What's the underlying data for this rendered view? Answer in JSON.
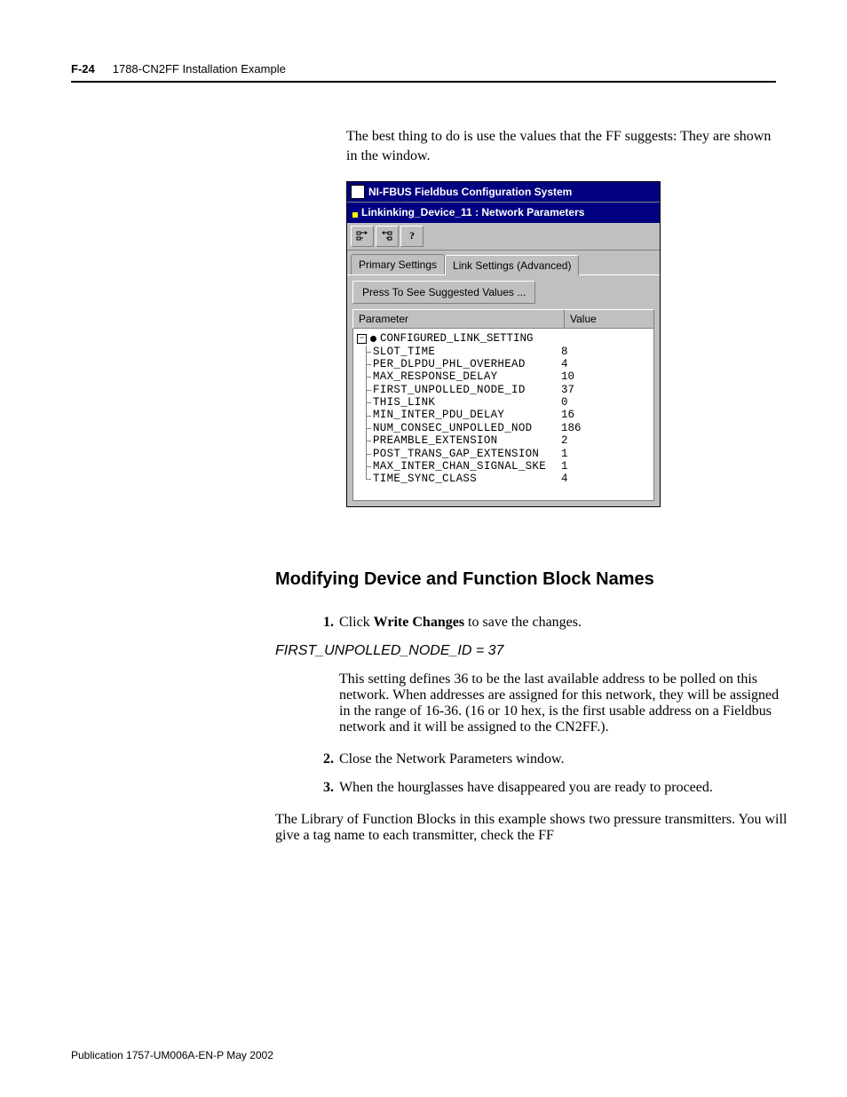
{
  "header": {
    "page_number": "F-24",
    "chapter_title": "1788-CN2FF Installation Example"
  },
  "intro": "The best thing to do is use the values that the FF suggests: They are shown in the window.",
  "screenshot": {
    "app_title": "NI-FBUS Fieldbus Configuration System",
    "window_title": "Linkinking_Device_11 : Network Parameters",
    "tabs": {
      "primary": "Primary Settings",
      "advanced": "Link Settings (Advanced)"
    },
    "suggest_button": "Press To See Suggested Values ...",
    "columns": {
      "param": "Parameter",
      "value": "Value"
    },
    "root": "CONFIGURED_LINK_SETTING",
    "rows": [
      {
        "name": "SLOT_TIME",
        "value": "8"
      },
      {
        "name": "PER_DLPDU_PHL_OVERHEAD",
        "value": "4"
      },
      {
        "name": "MAX_RESPONSE_DELAY",
        "value": "10"
      },
      {
        "name": "FIRST_UNPOLLED_NODE_ID",
        "value": "37"
      },
      {
        "name": "THIS_LINK",
        "value": "0"
      },
      {
        "name": "MIN_INTER_PDU_DELAY",
        "value": "16"
      },
      {
        "name": "NUM_CONSEC_UNPOLLED_NOD",
        "value": "186"
      },
      {
        "name": "PREAMBLE_EXTENSION",
        "value": "2"
      },
      {
        "name": "POST_TRANS_GAP_EXTENSION",
        "value": "1"
      },
      {
        "name": "MAX_INTER_CHAN_SIGNAL_SKE",
        "value": "1"
      },
      {
        "name": "TIME_SYNC_CLASS",
        "value": "4"
      }
    ]
  },
  "section_heading": "Modifying Device and Function Block Names",
  "step1_pre": "Click ",
  "step1_bold": "Write Changes",
  "step1_post": " to save the changes.",
  "subhead": "FIRST_UNPOLLED_NODE_ID = 37",
  "sub_para": "This setting defines 36 to be the last available address to be polled on this network. When addresses are assigned for this network, they will be assigned in the range of 16-36. (16 or 10 hex, is the first usable address on a Fieldbus network and it will be assigned to the CN2FF.).",
  "step2": "Close the Network Parameters window.",
  "step3": "When the hourglasses have disappeared you are ready to proceed.",
  "closing": "The Library of Function Blocks in this example shows two pressure transmitters. You will give a tag name to each transmitter, check the FF",
  "footer": "Publication 1757-UM006A-EN-P May 2002"
}
